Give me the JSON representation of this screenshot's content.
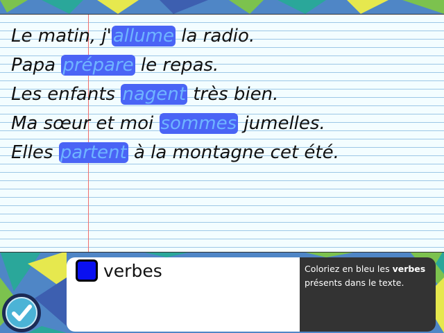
{
  "sentences": [
    {
      "before": "Le matin, j'",
      "verb": "allume",
      "after": " la radio."
    },
    {
      "before": "Papa ",
      "verb": "prépare",
      "after": " le repas."
    },
    {
      "before": "Les enfants ",
      "verb": "nagent",
      "after": " très bien."
    },
    {
      "before": "Ma sœur et moi ",
      "verb": "sommes",
      "after": " jumelles."
    },
    {
      "before": "Elles ",
      "verb": "partent",
      "after": " à la montagne cet été."
    }
  ],
  "legend": {
    "swatch_color": "#0a10f0",
    "label": "verbes"
  },
  "instructions": {
    "part1": "Coloriez en bleu les ",
    "bold": "verbes",
    "part2": " présents dans le texte."
  },
  "colors": {
    "highlight": "#4a64f5",
    "highlight_text": "#6fb4ff",
    "panel_dark": "#333333"
  },
  "icons": {
    "validate": "checkmark-icon"
  }
}
